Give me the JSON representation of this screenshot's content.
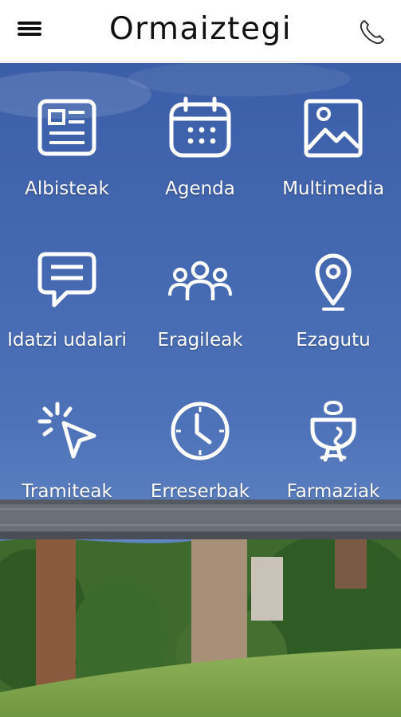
{
  "header": {
    "title": "Ormaiztegi",
    "menu_icon": "hamburger-menu-icon",
    "phone_icon": "phone-icon"
  },
  "colors": {
    "sky_top": "#3a5ba8",
    "sky_bottom": "#6f93c8",
    "icon_white": "#ffffff",
    "header_bg": "#ffffff"
  },
  "menu": [
    {
      "label": "Albisteak",
      "icon": "newspaper-icon"
    },
    {
      "label": "Agenda",
      "icon": "calendar-icon"
    },
    {
      "label": "Multimedia",
      "icon": "image-icon"
    },
    {
      "label": "Idatzi udalari",
      "icon": "message-icon"
    },
    {
      "label": "Eragileak",
      "icon": "people-icon"
    },
    {
      "label": "Ezagutu",
      "icon": "location-pin-icon"
    },
    {
      "label": "Tramiteak",
      "icon": "cursor-click-icon"
    },
    {
      "label": "Erreserbak",
      "icon": "clock-icon"
    },
    {
      "label": "Farmaziak",
      "icon": "pharmacy-icon"
    }
  ]
}
